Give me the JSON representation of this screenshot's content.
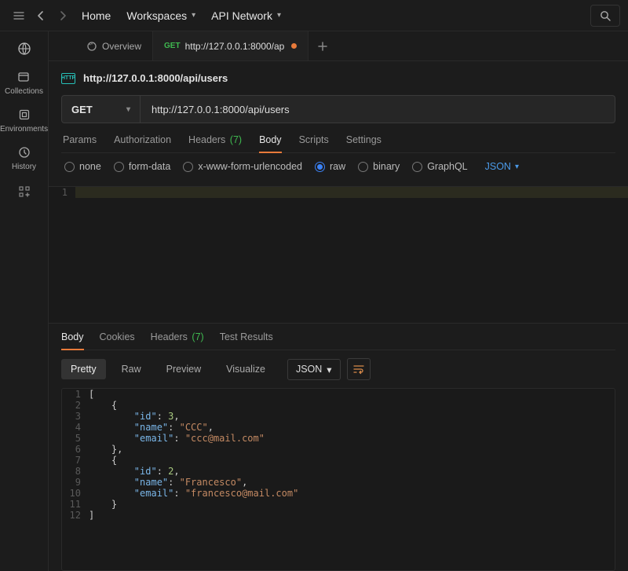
{
  "topnav": {
    "home": "Home",
    "workspaces": "Workspaces",
    "api_network": "API Network"
  },
  "sidebar": {
    "collections": "Collections",
    "environments": "Environments",
    "history": "History"
  },
  "tabs": [
    {
      "kind": "overview",
      "label": "Overview"
    },
    {
      "kind": "request",
      "method": "GET",
      "label": "http://127.0.0.1:8000/ap",
      "dirty": true,
      "active": true
    }
  ],
  "request": {
    "title": "http://127.0.0.1:8000/api/users",
    "method": "GET",
    "url": "http://127.0.0.1:8000/api/users",
    "tabs": {
      "params": "Params",
      "authorization": "Authorization",
      "headers": "Headers",
      "headers_count": "(7)",
      "body": "Body",
      "scripts": "Scripts",
      "settings": "Settings"
    },
    "body_types": {
      "none": "none",
      "form_data": "form-data",
      "urlencoded": "x-www-form-urlencoded",
      "raw": "raw",
      "binary": "binary",
      "graphql": "GraphQL"
    },
    "body_format": "JSON",
    "body_lines": [
      ""
    ]
  },
  "response": {
    "tabs": {
      "body": "Body",
      "cookies": "Cookies",
      "headers": "Headers",
      "headers_count": "(7)",
      "test_results": "Test Results"
    },
    "views": {
      "pretty": "Pretty",
      "raw": "Raw",
      "preview": "Preview",
      "visualize": "Visualize"
    },
    "format": "JSON",
    "json": [
      {
        "id": 3,
        "name": "CCC",
        "email": "ccc@mail.com"
      },
      {
        "id": 2,
        "name": "Francesco",
        "email": "francesco@mail.com"
      }
    ]
  }
}
